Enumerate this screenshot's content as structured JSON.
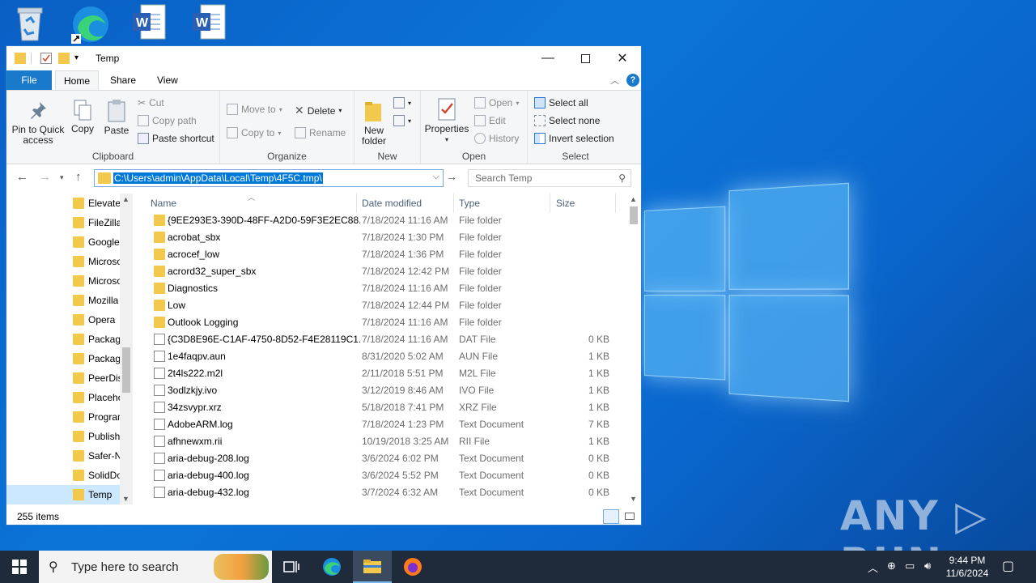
{
  "window": {
    "title": "Temp",
    "tabs": {
      "file": "File",
      "home": "Home",
      "share": "Share",
      "view": "View"
    }
  },
  "ribbon": {
    "clipboard": {
      "label": "Clipboard",
      "pin": "Pin to Quick access",
      "copy": "Copy",
      "paste": "Paste",
      "cut": "Cut",
      "copy_path": "Copy path",
      "paste_shortcut": "Paste shortcut"
    },
    "organize": {
      "label": "Organize",
      "move_to": "Move to",
      "copy_to": "Copy to",
      "delete": "Delete",
      "rename": "Rename"
    },
    "new": {
      "label": "New",
      "new_folder": "New folder"
    },
    "open": {
      "label": "Open",
      "properties": "Properties",
      "open": "Open",
      "edit": "Edit",
      "history": "History"
    },
    "select": {
      "label": "Select",
      "select_all": "Select all",
      "select_none": "Select none",
      "invert": "Invert selection"
    }
  },
  "address": {
    "path": "C:\\Users\\admin\\AppData\\Local\\Temp\\4F5C.tmp\\",
    "search_placeholder": "Search Temp"
  },
  "nav_items": [
    {
      "label": "Elevate"
    },
    {
      "label": "FileZilla"
    },
    {
      "label": "Google"
    },
    {
      "label": "Microso"
    },
    {
      "label": "Microso"
    },
    {
      "label": "Mozilla"
    },
    {
      "label": "Opera"
    },
    {
      "label": "Packag"
    },
    {
      "label": "Packag"
    },
    {
      "label": "PeerDis"
    },
    {
      "label": "Placeho"
    },
    {
      "label": "Prograr"
    },
    {
      "label": "Publish"
    },
    {
      "label": "Safer-N"
    },
    {
      "label": "SolidDo"
    },
    {
      "label": "Temp"
    }
  ],
  "columns": {
    "name": "Name",
    "date": "Date modified",
    "type": "Type",
    "size": "Size"
  },
  "files": [
    {
      "name": "{9EE293E3-390D-48FF-A2D0-59F3E2EC88...",
      "date": "7/18/2024 11:16 AM",
      "type": "File folder",
      "size": "",
      "kind": "folder"
    },
    {
      "name": "acrobat_sbx",
      "date": "7/18/2024 1:30 PM",
      "type": "File folder",
      "size": "",
      "kind": "folder"
    },
    {
      "name": "acrocef_low",
      "date": "7/18/2024 1:36 PM",
      "type": "File folder",
      "size": "",
      "kind": "folder"
    },
    {
      "name": "acrord32_super_sbx",
      "date": "7/18/2024 12:42 PM",
      "type": "File folder",
      "size": "",
      "kind": "folder"
    },
    {
      "name": "Diagnostics",
      "date": "7/18/2024 11:16 AM",
      "type": "File folder",
      "size": "",
      "kind": "folder"
    },
    {
      "name": "Low",
      "date": "7/18/2024 12:44 PM",
      "type": "File folder",
      "size": "",
      "kind": "folder"
    },
    {
      "name": "Outlook Logging",
      "date": "7/18/2024 11:16 AM",
      "type": "File folder",
      "size": "",
      "kind": "folder"
    },
    {
      "name": "{C3D8E96E-C1AF-4750-8D52-F4E28119C1...",
      "date": "7/18/2024 11:16 AM",
      "type": "DAT File",
      "size": "0 KB",
      "kind": "file"
    },
    {
      "name": "1e4faqpv.aun",
      "date": "8/31/2020 5:02 AM",
      "type": "AUN File",
      "size": "1 KB",
      "kind": "file"
    },
    {
      "name": "2t4ls222.m2l",
      "date": "2/11/2018 5:51 PM",
      "type": "M2L File",
      "size": "1 KB",
      "kind": "file"
    },
    {
      "name": "3odlzkjy.ivo",
      "date": "3/12/2019 8:46 AM",
      "type": "IVO File",
      "size": "1 KB",
      "kind": "file"
    },
    {
      "name": "34zsvypr.xrz",
      "date": "5/18/2018 7:41 PM",
      "type": "XRZ File",
      "size": "1 KB",
      "kind": "file"
    },
    {
      "name": "AdobeARM.log",
      "date": "7/18/2024 1:23 PM",
      "type": "Text Document",
      "size": "7 KB",
      "kind": "file"
    },
    {
      "name": "afhnewxm.rii",
      "date": "10/19/2018 3:25 AM",
      "type": "RII File",
      "size": "1 KB",
      "kind": "file"
    },
    {
      "name": "aria-debug-208.log",
      "date": "3/6/2024 6:02 PM",
      "type": "Text Document",
      "size": "0 KB",
      "kind": "file"
    },
    {
      "name": "aria-debug-400.log",
      "date": "3/6/2024 5:52 PM",
      "type": "Text Document",
      "size": "0 KB",
      "kind": "file"
    },
    {
      "name": "aria-debug-432.log",
      "date": "3/7/2024 6:32 AM",
      "type": "Text Document",
      "size": "0 KB",
      "kind": "file"
    }
  ],
  "status": {
    "count": "255 items"
  },
  "taskbar": {
    "search_placeholder": "Type here to search",
    "time": "9:44 PM",
    "date": "11/6/2024"
  },
  "watermark": "ANY RUN"
}
